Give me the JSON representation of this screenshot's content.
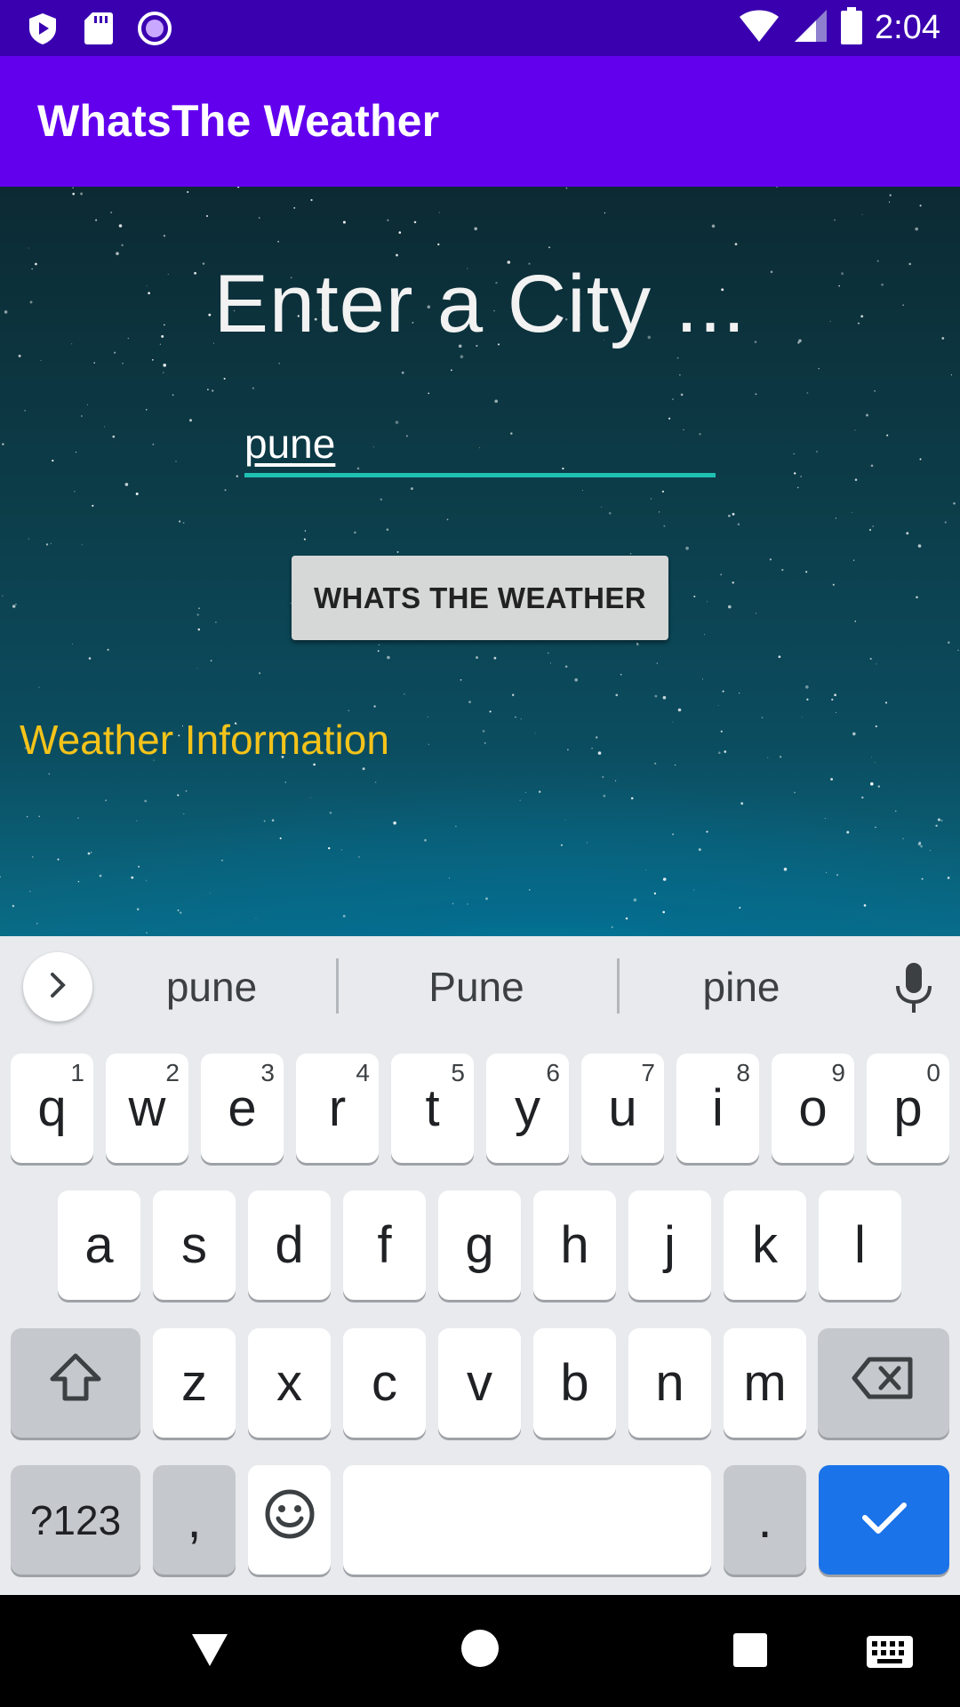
{
  "status_bar": {
    "time": "2:04",
    "left_icons": [
      "play-protect-icon",
      "sd-card-icon",
      "record-icon"
    ],
    "right_icons": [
      "wifi-icon",
      "cell-signal-icon",
      "battery-icon"
    ]
  },
  "app_bar": {
    "title": "WhatsThe Weather"
  },
  "main": {
    "heading": "Enter a City ...",
    "city_input": {
      "value": "pune"
    },
    "button_label": "WHATS THE WEATHER",
    "weather_info": "Weather Information"
  },
  "keyboard": {
    "suggestions": [
      "pune",
      "Pune",
      "pine"
    ],
    "rows": [
      [
        {
          "key": "q",
          "hint": "1"
        },
        {
          "key": "w",
          "hint": "2"
        },
        {
          "key": "e",
          "hint": "3"
        },
        {
          "key": "r",
          "hint": "4"
        },
        {
          "key": "t",
          "hint": "5"
        },
        {
          "key": "y",
          "hint": "6"
        },
        {
          "key": "u",
          "hint": "7"
        },
        {
          "key": "i",
          "hint": "8"
        },
        {
          "key": "o",
          "hint": "9"
        },
        {
          "key": "p",
          "hint": "0"
        }
      ],
      [
        {
          "key": "a"
        },
        {
          "key": "s"
        },
        {
          "key": "d"
        },
        {
          "key": "f"
        },
        {
          "key": "g"
        },
        {
          "key": "h"
        },
        {
          "key": "j"
        },
        {
          "key": "k"
        },
        {
          "key": "l"
        }
      ],
      [
        {
          "key": "z"
        },
        {
          "key": "x"
        },
        {
          "key": "c"
        },
        {
          "key": "v"
        },
        {
          "key": "b"
        },
        {
          "key": "n"
        },
        {
          "key": "m"
        }
      ]
    ],
    "symbols_label": "?123",
    "comma_label": ",",
    "period_label": ".",
    "icons": [
      "shift-icon",
      "backspace-icon",
      "emoji-icon",
      "checkmark-icon",
      "mic-icon",
      "chevron-right-icon"
    ],
    "accent_color": "#1a73e8"
  },
  "nav_bar": {
    "icons": [
      "back-icon",
      "home-icon",
      "recents-icon",
      "keyboard-switch-icon"
    ]
  },
  "colors": {
    "status_bar": "#3a00b0",
    "app_bar": "#6200ee",
    "input_underline": "#1fc2b2",
    "weather_info_text": "#f4c31a",
    "button_bg": "#d6d7d7"
  }
}
